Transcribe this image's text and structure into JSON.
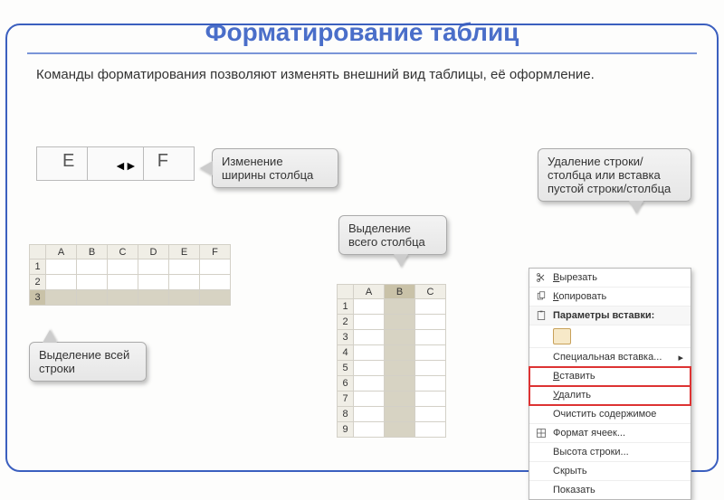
{
  "title": "Форматирование таблиц",
  "intro": "Команды форматирования позволяют изменять внешний вид таблицы, её оформление.",
  "ef": {
    "E": "E",
    "F": "F",
    "cursor": "◄►"
  },
  "callouts": {
    "width": "Изменение ширины столбца",
    "selcol": "Выделение всего столбца",
    "selrow": "Выделение всей строки",
    "delete": "Удаление строки/столбца или вставка пустой строки/столбца"
  },
  "sheet_row": {
    "cols": [
      "A",
      "B",
      "C",
      "D",
      "E",
      "F"
    ],
    "rows": [
      "1",
      "2",
      "3"
    ],
    "selected_row": "3"
  },
  "sheet_col": {
    "cols": [
      "A",
      "B",
      "C"
    ],
    "rows": [
      "1",
      "2",
      "3",
      "4",
      "5",
      "6",
      "7",
      "8",
      "9"
    ],
    "selected_col": "B"
  },
  "ctx": {
    "cut": "Вырезать",
    "copy": "Копировать",
    "paste_header": "Параметры вставки:",
    "special": "Специальная вставка...",
    "insert": "Вставить",
    "delete": "Удалить",
    "clear": "Очистить содержимое",
    "format": "Формат ячеек...",
    "rowheight": "Высота строки...",
    "hide": "Скрыть",
    "show": "Показать"
  }
}
